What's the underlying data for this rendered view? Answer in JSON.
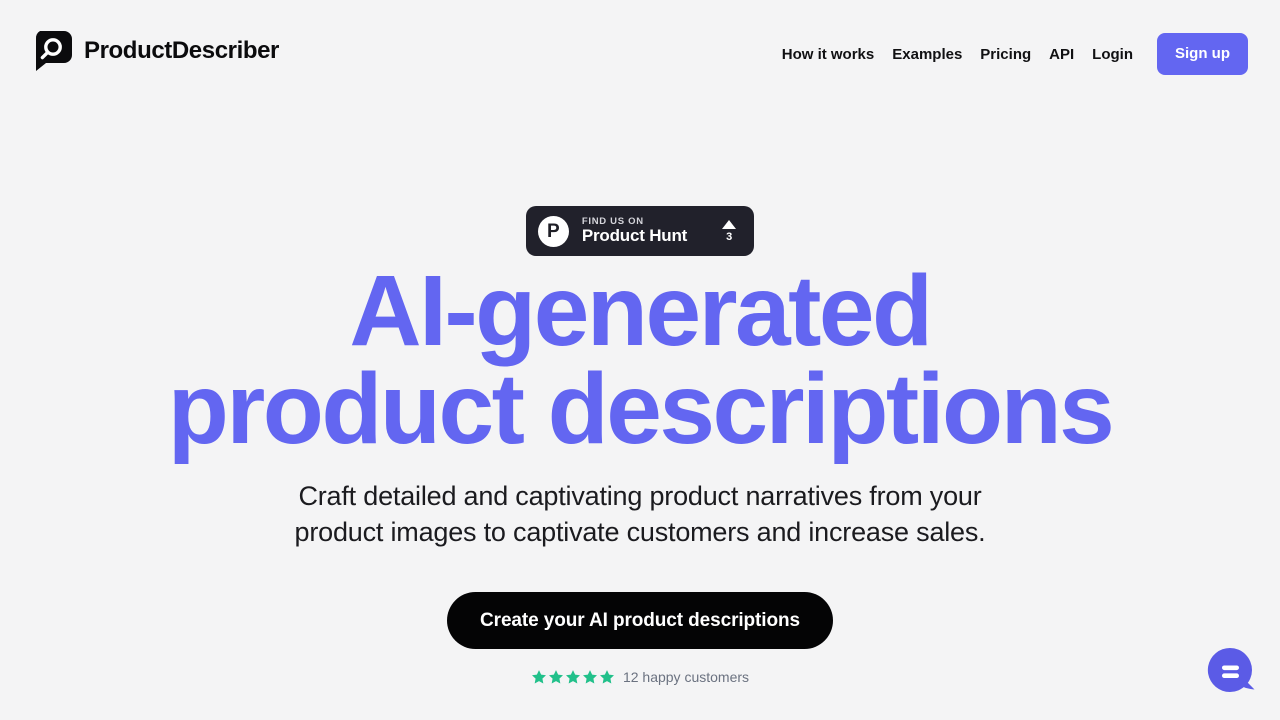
{
  "colors": {
    "background": "#f4f4f5",
    "accent": "#6366f1",
    "cta_background": "#040405",
    "badge_background": "#21212b",
    "star": "#21c08a",
    "muted_text": "#6b7280"
  },
  "header": {
    "brand": {
      "name": "ProductDescriber",
      "logo_icon": "magnifier-speech-bubble-icon"
    },
    "nav": [
      {
        "label": "How it works"
      },
      {
        "label": "Examples"
      },
      {
        "label": "Pricing"
      },
      {
        "label": "API"
      },
      {
        "label": "Login"
      }
    ],
    "signup_label": "Sign up"
  },
  "hero": {
    "product_hunt_badge": {
      "logo_letter": "P",
      "eyebrow": "FIND US ON",
      "title": "Product Hunt",
      "upvote_icon": "caret-up-icon",
      "upvote_count": "3"
    },
    "title_line_1": "AI-generated",
    "title_line_2": "product descriptions",
    "subtitle": "Craft detailed and captivating product narratives from your product images to captivate customers and increase sales.",
    "cta_label": "Create your AI product descriptions",
    "social_proof": {
      "star_count": 5,
      "star_icon": "star-icon",
      "text": "12 happy customers"
    }
  },
  "chat_widget": {
    "icon": "chat-bubble-icon",
    "color": "#5b5be6"
  }
}
